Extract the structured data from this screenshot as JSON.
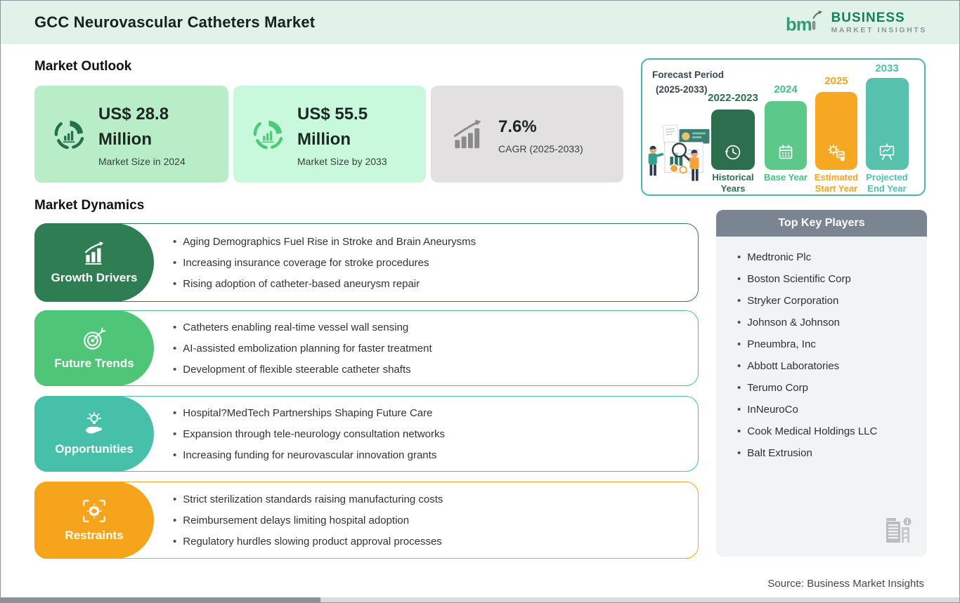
{
  "header": {
    "title": "GCC Neurovascular Catheters Market"
  },
  "logo": {
    "mark": "bmi",
    "mark_text": "bm",
    "line1": "BUSINESS",
    "line2": "MARKET INSIGHTS"
  },
  "market_outlook": {
    "heading": "Market Outlook",
    "cards": [
      {
        "value_line1": "US$ 28.8",
        "value_line2": "Million",
        "label": "Market Size in 2024",
        "icon": "donut-bars-icon",
        "bg": "#b9edc8",
        "accent": "#23704c"
      },
      {
        "value_line1": "US$ 55.5",
        "value_line2": "Million",
        "label": "Market Size by 2033",
        "icon": "donut-bars-icon",
        "bg": "#c9f9dc",
        "accent": "#4fc878"
      },
      {
        "value_line1": "7.6%",
        "value_line2": "",
        "label": "CAGR (2025-2033)",
        "icon": "rising-bars-arrow-icon",
        "bg": "#e2e0e1",
        "accent": "#8a8a8a"
      }
    ]
  },
  "forecast_panel": {
    "title_line1": "Forecast Period",
    "title_line2": "(2025-2033)",
    "border_color": "#4cb5a3",
    "chart_data": {
      "type": "bar",
      "categories": [
        "2022-2023",
        "2024",
        "2025",
        "2033"
      ],
      "labels": [
        "Historical Years",
        "Base Year",
        "Estimated Start Year",
        "Projected End Year"
      ],
      "relative_heights": [
        86,
        98,
        111,
        131
      ],
      "colors": [
        "#2c6e4e",
        "#5cc98b",
        "#f7a823",
        "#56c2ad"
      ],
      "icons": [
        "clock-history-icon",
        "calendar-icon",
        "gear-chart-icon",
        "presentation-chart-icon"
      ]
    }
  },
  "market_dynamics": {
    "heading": "Market Dynamics",
    "rows": [
      {
        "label": "Growth Drivers",
        "color": "#2e7d53",
        "icon": "growth-chart-icon",
        "bullets": [
          "Aging Demographics Fuel Rise in Stroke and Brain Aneurysms",
          "Increasing insurance coverage for stroke procedures",
          "Rising adoption of catheter-based aneurysm repair"
        ]
      },
      {
        "label": "Future Trends",
        "color": "#4ec577",
        "icon": "target-icon",
        "bullets": [
          "Catheters enabling real-time vessel wall sensing",
          "AI-assisted embolization planning for faster treatment",
          "Development of flexible steerable catheter shafts"
        ]
      },
      {
        "label": "Opportunities",
        "color": "#47c0a9",
        "icon": "idea-hand-icon",
        "bullets": [
          "Hospital?MedTech Partnerships Shaping Future Care",
          "Expansion through tele-neurology consultation networks",
          "Increasing funding for neurovascular innovation grants"
        ]
      },
      {
        "label": "Restraints",
        "color": "#f7a41d",
        "icon": "chain-link-icon",
        "bullets": [
          "Strict sterilization standards raising manufacturing costs",
          "Reimbursement delays limiting hospital adoption",
          "Regulatory hurdles slowing product approval processes"
        ]
      }
    ]
  },
  "key_players": {
    "heading": "Top Key Players",
    "items": [
      "Medtronic Plc",
      "Boston Scientific Corp",
      "Stryker Corporation",
      "Johnson & Johnson",
      "Pneumbra, Inc",
      "Abbott Laboratories",
      "Terumo Corp",
      "InNeuroCo",
      "Cook Medical Holdings LLC",
      "Balt Extrusion"
    ],
    "footer_icon": "building-info-icon"
  },
  "footer": {
    "source": "Source: Business Market Insights"
  },
  "colors": {
    "header_bg": "#e1f2e8",
    "green_dark": "#2e7d53",
    "green": "#4ec577",
    "teal": "#47c0a9",
    "orange": "#f7a41d",
    "players_header": "#7b8591",
    "players_bg": "#f1f3f5"
  }
}
